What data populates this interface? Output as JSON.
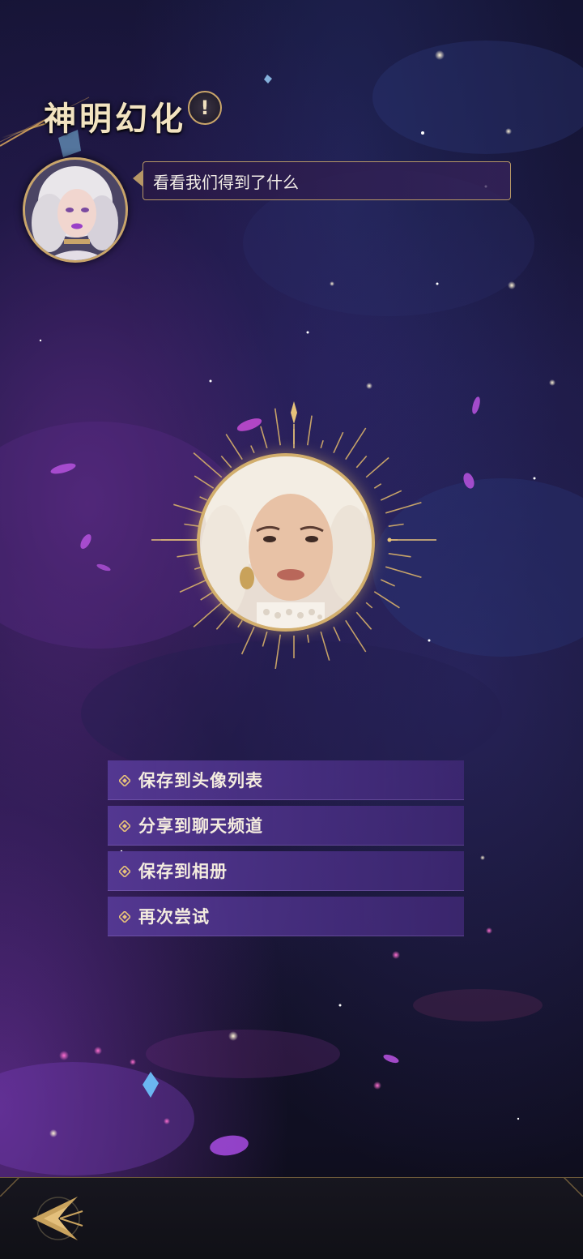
{
  "header": {
    "title": "神明幻化",
    "info_icon": "exclamation-icon"
  },
  "npc": {
    "avatar": "npc-portrait",
    "speech": "看看我们得到了什么"
  },
  "result": {
    "portrait": "generated-portrait"
  },
  "menu": {
    "items": [
      {
        "label": "保存到头像列表",
        "icon": "diamond-bullet-icon"
      },
      {
        "label": "分享到聊天频道",
        "icon": "diamond-bullet-icon"
      },
      {
        "label": "保存到相册",
        "icon": "diamond-bullet-icon"
      },
      {
        "label": "再次尝试",
        "icon": "diamond-bullet-icon"
      }
    ]
  },
  "footer": {
    "back_icon": "back-arrow-icon"
  },
  "colors": {
    "accent_gold": "#c9a56a",
    "menu_purple": "#56399a",
    "title_text": "#f2e3c0"
  }
}
